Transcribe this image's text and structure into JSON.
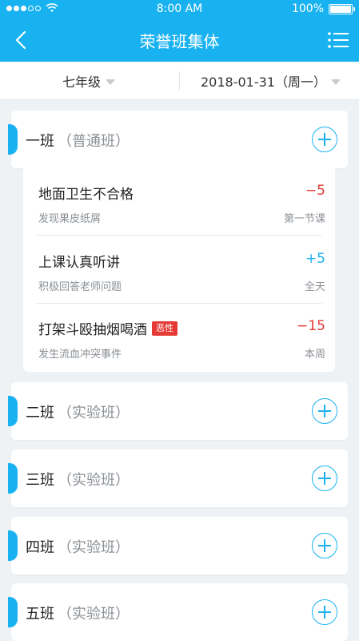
{
  "status": {
    "time": "8:00 AM",
    "battery": "100%"
  },
  "nav": {
    "title": "荣誉班集体"
  },
  "filters": {
    "grade": "七年级",
    "date": "2018-01-31（周一）"
  },
  "classes": [
    {
      "name": "一班",
      "type": "（普通班）"
    },
    {
      "name": "二班",
      "type": "（实验班）"
    },
    {
      "name": "三班",
      "type": "（实验班）"
    },
    {
      "name": "四班",
      "type": "（实验班）"
    },
    {
      "name": "五班",
      "type": "（实验班）"
    }
  ],
  "records": [
    {
      "title": "地面卫生不合格",
      "desc": "发现果皮纸屑",
      "score": "−5",
      "period": "第一节课",
      "badge": ""
    },
    {
      "title": "上课认真听讲",
      "desc": "积极回答老师问题",
      "score": "+5",
      "period": "全天",
      "badge": ""
    },
    {
      "title": "打架斗殴抽烟喝酒",
      "desc": "发生流血冲突事件",
      "score": "−15",
      "period": "本周",
      "badge": "恶性"
    }
  ],
  "colors": {
    "primary": "#19b2f0",
    "negative": "#e53935",
    "background": "#eef2f5"
  },
  "icons": {
    "back": "back-chevron-icon",
    "menu": "list-menu-icon",
    "add": "plus-circle-icon",
    "caret": "caret-down-icon"
  }
}
